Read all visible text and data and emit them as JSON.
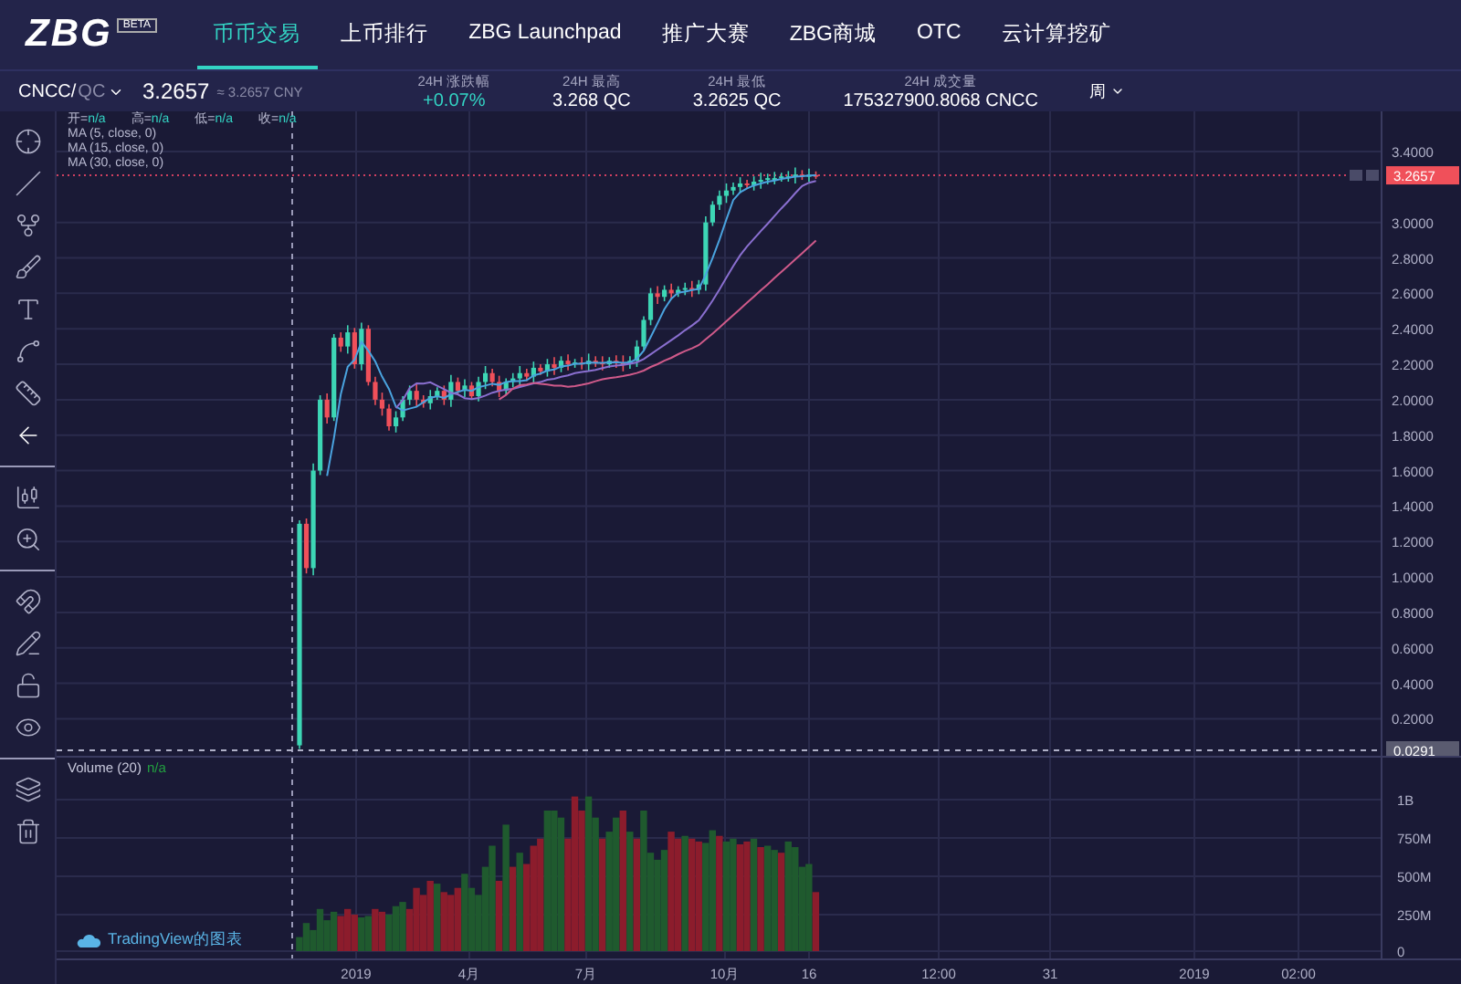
{
  "nav": {
    "logo": "ZBG",
    "badge": "BETA",
    "tabs": [
      {
        "label": "币币交易",
        "selected": true
      },
      {
        "label": "上币排行",
        "selected": false
      },
      {
        "label": "ZBG Launchpad",
        "selected": false
      },
      {
        "label": "推广大赛",
        "selected": false
      },
      {
        "label": "ZBG商城",
        "selected": false
      },
      {
        "label": "OTC",
        "selected": false
      },
      {
        "label": "云计算挖矿",
        "selected": false
      }
    ]
  },
  "ticker": {
    "pair": "CNCC/",
    "quote": "QC",
    "price": "3.2657",
    "price_cny": "≈ 3.2657 CNY",
    "stats": [
      {
        "label": "24H 涨跌幅",
        "value": "+0.07%",
        "kind": "change"
      },
      {
        "label": "24H 最高",
        "value": "3.268 QC",
        "kind": "plain"
      },
      {
        "label": "24H 最低",
        "value": "3.2625 QC",
        "kind": "plain"
      },
      {
        "label": "24H 成交量",
        "value": "175327900.8068 CNCC",
        "kind": "plain"
      }
    ],
    "period": "周"
  },
  "chart": {
    "legend": [
      {
        "label": "开=",
        "value": "n/a"
      },
      {
        "label": "高=",
        "value": "n/a"
      },
      {
        "label": "低=",
        "value": "n/a"
      },
      {
        "label": "收=",
        "value": "n/a"
      }
    ],
    "studies": [
      "MA (5, close, 0)",
      "MA (15, close, 0)",
      "MA (30, close, 0)"
    ],
    "price_labels": [
      "3.4000",
      "3.0000",
      "2.8000",
      "2.6000",
      "2.4000",
      "2.2000",
      "2.0000",
      "1.8000",
      "1.6000",
      "1.4000",
      "1.2000",
      "1.0000",
      "0.8000",
      "0.6000",
      "0.4000",
      "0.2000"
    ],
    "last_price": "3.2657",
    "low_price": "0.0291",
    "volume": {
      "title": "Volume (20)",
      "value": "n/a",
      "labels": [
        "1B",
        "750M",
        "500M",
        "250M",
        "0"
      ]
    },
    "time_labels": [
      "2019",
      "4月",
      "7月",
      "10月",
      "16",
      "12:00",
      "31",
      "2019",
      "02:00"
    ],
    "attribution": "TradingView的图表"
  }
}
